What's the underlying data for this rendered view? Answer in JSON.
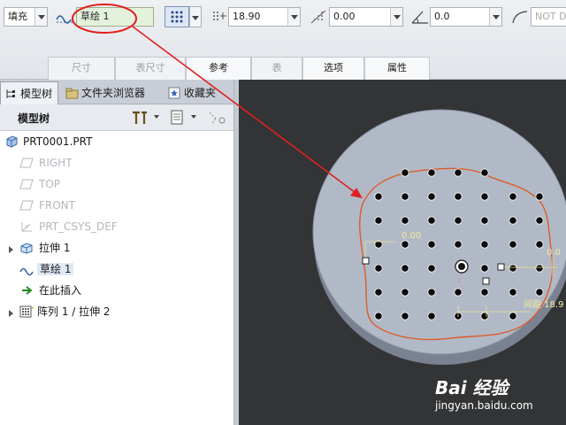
{
  "dashboard": {
    "fill_type": "填充",
    "sketch_name": "草绘 1",
    "spacing_value": "18.90",
    "offset_value": "0.00",
    "angle_value": "0.0",
    "not_label": "NOT D"
  },
  "tabs": [
    {
      "label": "尺寸",
      "active": false
    },
    {
      "label": "表尺寸",
      "active": false
    },
    {
      "label": "参考",
      "active": true
    },
    {
      "label": "表",
      "active": false
    },
    {
      "label": "选项",
      "active": true
    },
    {
      "label": "属性",
      "active": true
    }
  ],
  "panel_tabs": {
    "model_tree": "模型树",
    "folder_browser": "文件夹浏览器",
    "favorites": "收藏夹"
  },
  "nav_header": "模型树",
  "tree": [
    {
      "label": "PRT0001.PRT",
      "dim": false,
      "icon": "part-icon"
    },
    {
      "label": "RIGHT",
      "dim": true,
      "icon": "datum-plane-icon"
    },
    {
      "label": "TOP",
      "dim": true,
      "icon": "datum-plane-icon"
    },
    {
      "label": "FRONT",
      "dim": true,
      "icon": "datum-plane-icon"
    },
    {
      "label": "PRT_CSYS_DEF",
      "dim": true,
      "icon": "csys-icon"
    },
    {
      "label": "拉伸 1",
      "dim": false,
      "icon": "extrude-icon"
    },
    {
      "label": "草绘 1",
      "dim": false,
      "icon": "sketch-icon"
    },
    {
      "label": "在此插入",
      "dim": false,
      "icon": "insert-arrow-icon"
    },
    {
      "label": "阵列 1 / 拉伸 2",
      "dim": false,
      "icon": "pattern-icon"
    }
  ],
  "viewport": {
    "dim_left": "0.00",
    "dim_right": "0.0",
    "dim_spacing": "间距 18.9",
    "dim_i": "i"
  },
  "watermark": {
    "brand": "Bai 经验",
    "url": "jingyan.baidu.com"
  },
  "colors": {
    "disc_top": "#b1b9c7",
    "disc_side": "#7a8190",
    "boundary": "#e0551c",
    "annotation_arrow": "#e02020"
  }
}
